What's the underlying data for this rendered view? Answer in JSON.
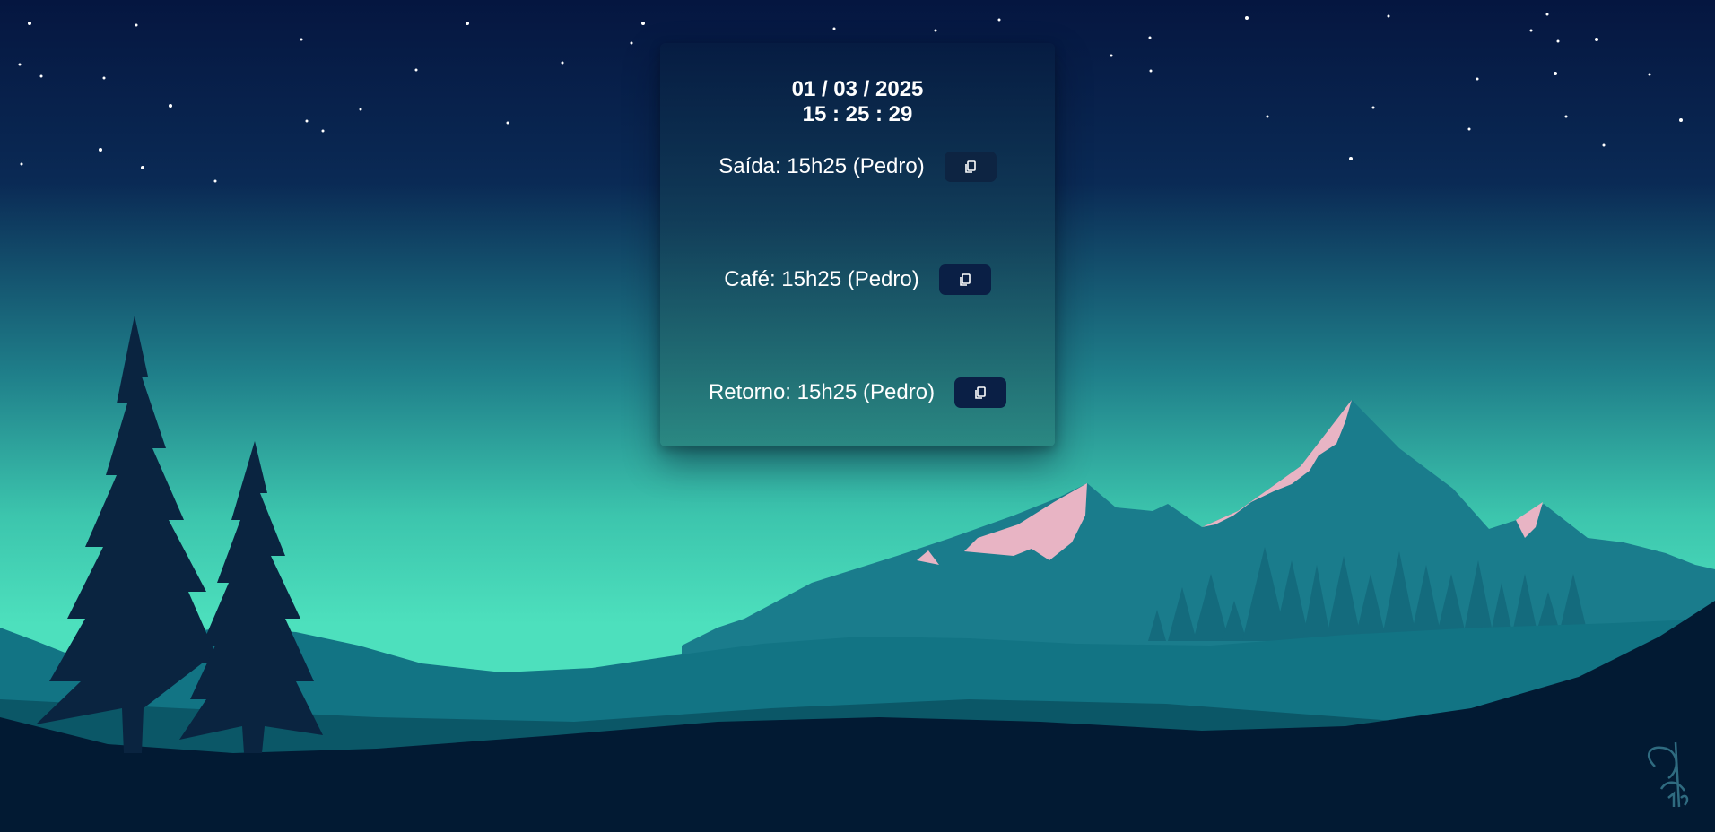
{
  "clock": {
    "date": "01 / 03 / 2025",
    "time": "15 : 25 : 29"
  },
  "entries": [
    {
      "label": "Saída: 15h25 (Pedro)",
      "action_icon": "copy-icon"
    },
    {
      "label": "Café: 15h25 (Pedro)",
      "action_icon": "copy-icon"
    },
    {
      "label": "Retorno: 15h25 (Pedro)",
      "action_icon": "copy-icon"
    }
  ],
  "colors": {
    "sky_top": "#051640",
    "sky_glow": "#4de0bd",
    "mountain_teal": "#147c8a",
    "snow_pink": "#e8b4c4",
    "foreground_dark": "#021a33",
    "button_bg": "#0a1f45"
  }
}
